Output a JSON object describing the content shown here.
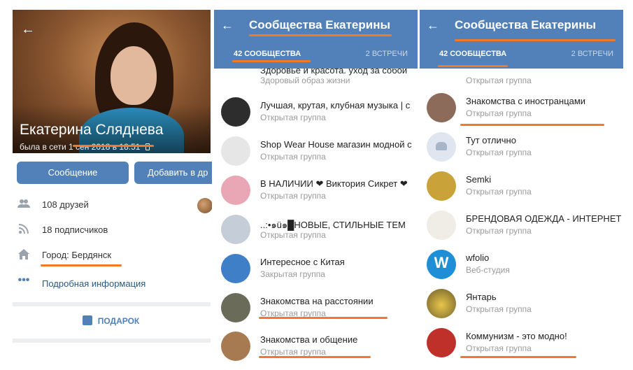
{
  "profile": {
    "name": "Екатерина Сляднева",
    "online": "была в сети 1 сен 2018 в 18:51",
    "phone_icon": "phone-icon",
    "buttons": {
      "message": "Сообщение",
      "add": "Добавить в др"
    },
    "rows": [
      {
        "icon": "friends-icon",
        "text": "108 друзей"
      },
      {
        "icon": "followers-icon",
        "text": "18 подписчиков"
      },
      {
        "icon": "home-icon",
        "text": "Город: Бердянск"
      },
      {
        "icon": "more-dots-icon",
        "text": "Подробная информация"
      }
    ],
    "gift_label": "ПОДАРОК"
  },
  "communities": {
    "title": "Сообщества Екатерины",
    "tabs": {
      "communities": "42 СООБЩЕСТВА",
      "events": "2 ВСТРЕЧИ"
    },
    "list_left": [
      {
        "name": "Здоровье и красота. уход за собой",
        "sub": "Здоровый образ жизни",
        "color": "#c9a27a"
      },
      {
        "name": "Лучшая, крутая, клубная музыка | c",
        "sub": "Открытая группа",
        "color": "#2d2d2d"
      },
      {
        "name": "Shop Wear House магазин модной с",
        "sub": "Открытая группа",
        "color": "#e6e6e6"
      },
      {
        "name": "В НАЛИЧИИ ❤ Виктория Сикрет ❤",
        "sub": "Открытая группа",
        "color": "#e9a6b4"
      },
      {
        "name": "..:•๑ü๑█НОВЫЕ, СТИЛЬНЫЕ ТЕМ",
        "sub": "Открытая группа",
        "color": "#c5cdd8"
      },
      {
        "name": "Интересное с Китая",
        "sub": "Закрытая группа",
        "color": "#3f7fc7"
      },
      {
        "name": "Знакомства на расстоянии",
        "sub": "Открытая группа",
        "color": "#6b6b5a"
      },
      {
        "name": "Знакомства и общение",
        "sub": "Открытая группа",
        "color": "#a87a52"
      }
    ],
    "list_right": [
      {
        "name": "",
        "sub": "Открытая группа",
        "color": "#6a4a3a"
      },
      {
        "name": "Знакомства с иностранцами",
        "sub": "Открытая группа",
        "color": "#8c6b5a"
      },
      {
        "name": "Тут отлично",
        "sub": "Открытая группа",
        "color": "#dfe6ef"
      },
      {
        "name": "Semki",
        "sub": "Открытая группа",
        "color": "#c9a23a"
      },
      {
        "name": "БРЕНДОВАЯ ОДЕЖДА - ИНТЕРНЕТ",
        "sub": "Открытая группа",
        "color": "#f0ece6"
      },
      {
        "name": "wfolio",
        "sub": "Веб-студия",
        "color": "#1e8fd6"
      },
      {
        "name": "Янтарь",
        "sub": "Открытая группа",
        "color": "#d9b23a"
      },
      {
        "name": "Коммунизм - это модно!",
        "sub": "Открытая группа",
        "color": "#c0302a"
      }
    ]
  },
  "colors": {
    "accent": "#5181b8",
    "underline": "#f07a2a",
    "link": "#2a5885"
  }
}
